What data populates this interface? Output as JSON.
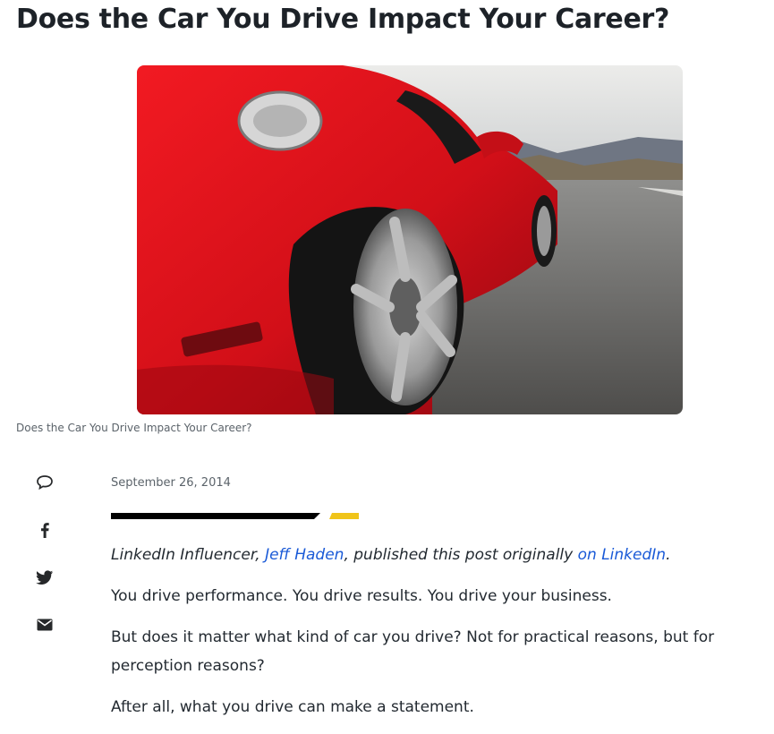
{
  "article": {
    "headline": "Does the Car You Drive Impact Your Career?",
    "image_caption": "Does the Car You Drive Impact Your Career?",
    "date": "September 26, 2014"
  },
  "share": {
    "items": [
      {
        "icon": "comment-icon"
      },
      {
        "icon": "facebook-icon"
      },
      {
        "icon": "twitter-icon"
      },
      {
        "icon": "email-icon"
      }
    ]
  },
  "colors": {
    "link": "#1a5ad7",
    "accent_yellow": "#f0c419",
    "car_red": "#d8121c"
  },
  "intro": {
    "prefix": "LinkedIn Influencer, ",
    "author_link": "Jeff Haden",
    "middle": ", published this post originally ",
    "source_link": "on LinkedIn",
    "suffix": "."
  },
  "paragraphs": [
    "You drive performance. You drive results. You drive your business.",
    "But does it matter what kind of car you drive? Not for practical reasons, but for perception reasons?",
    "After all, what you drive can make a statement."
  ]
}
